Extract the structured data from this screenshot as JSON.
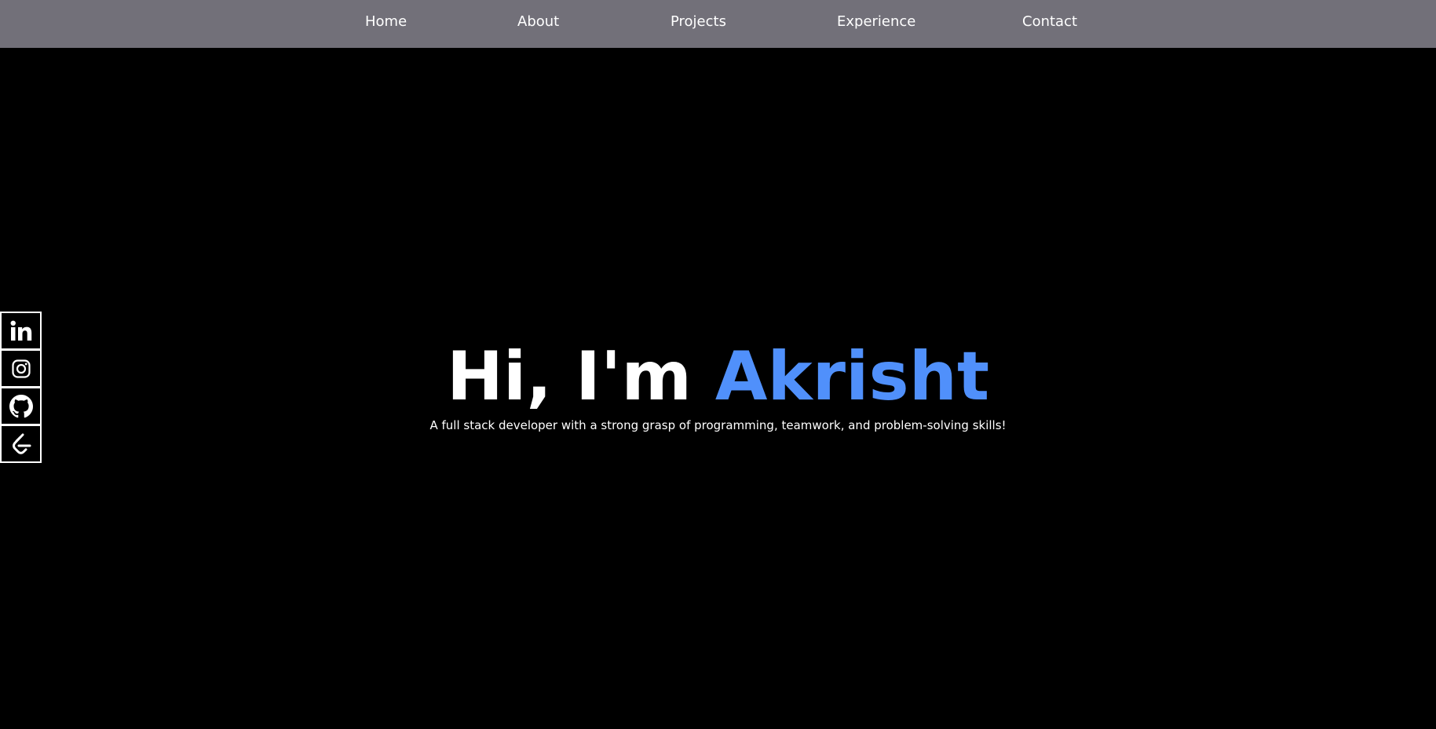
{
  "nav": {
    "items": [
      {
        "label": "Home"
      },
      {
        "label": "About"
      },
      {
        "label": "Projects"
      },
      {
        "label": "Experience"
      },
      {
        "label": "Contact"
      }
    ]
  },
  "hero": {
    "title_prefix": "Hi, I'm ",
    "title_name": "Akrisht",
    "subtitle": "A full stack developer with a strong grasp of programming, teamwork, and problem-solving skills!"
  },
  "social": {
    "icons": [
      "linkedin-icon",
      "instagram-icon",
      "github-icon",
      "leetcode-icon"
    ]
  },
  "colors": {
    "navbar_bg": "#727079",
    "page_bg": "#000000",
    "accent": "#5090fb",
    "text": "#ffffff"
  }
}
